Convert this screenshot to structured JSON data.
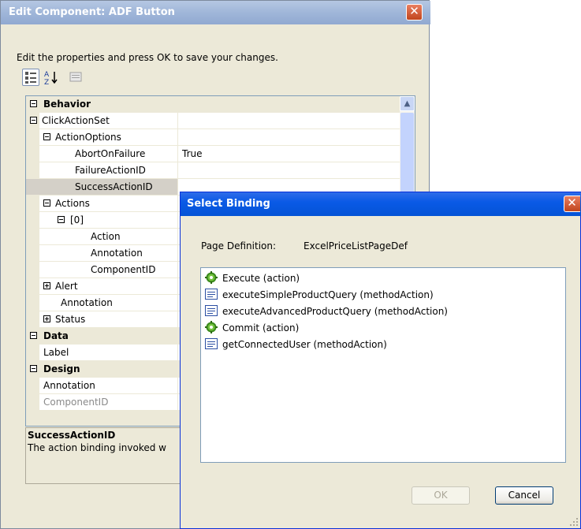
{
  "main_dialog": {
    "title": "Edit Component: ADF Button",
    "instructions": "Edit the properties and press OK to save your changes.",
    "toolbar": [
      "categorized-icon",
      "alphabetical-icon",
      "property-pages-icon"
    ],
    "grid": {
      "rows": [
        {
          "name": "Behavior",
          "value": "",
          "type": "category"
        },
        {
          "name": "ClickActionSet",
          "value": ""
        },
        {
          "name": "ActionOptions",
          "value": ""
        },
        {
          "name": "AbortOnFailure",
          "value": "True"
        },
        {
          "name": "FailureActionID",
          "value": ""
        },
        {
          "name": "SuccessActionID",
          "value": "",
          "selected": true
        },
        {
          "name": "Actions",
          "value": ""
        },
        {
          "name": "[0]",
          "value": ""
        },
        {
          "name": "Action",
          "value": ""
        },
        {
          "name": "Annotation",
          "value": ""
        },
        {
          "name": "ComponentID",
          "value": ""
        },
        {
          "name": "Alert",
          "value": ""
        },
        {
          "name": "Annotation",
          "value": ""
        },
        {
          "name": "Status",
          "value": ""
        },
        {
          "name": "Data",
          "value": "",
          "type": "category"
        },
        {
          "name": "Label",
          "value": ""
        },
        {
          "name": "Design",
          "value": "",
          "type": "category"
        },
        {
          "name": "Annotation",
          "value": ""
        },
        {
          "name": "ComponentID",
          "value": "",
          "disabled": true
        }
      ]
    },
    "description": {
      "title": "SuccessActionID",
      "text": "The action binding invoked w"
    }
  },
  "select_binding": {
    "title": "Select Binding",
    "page_definition_label": "Page Definition:",
    "page_definition_value": "ExcelPriceListPageDef",
    "items": [
      {
        "label": "Execute (action)",
        "icon": "gear-icon"
      },
      {
        "label": "executeSimpleProductQuery (methodAction)",
        "icon": "method-icon"
      },
      {
        "label": "executeAdvancedProductQuery (methodAction)",
        "icon": "method-icon"
      },
      {
        "label": "Commit (action)",
        "icon": "gear-icon"
      },
      {
        "label": "getConnectedUser (methodAction)",
        "icon": "method-icon"
      }
    ],
    "ok_label": "OK",
    "cancel_label": "Cancel"
  }
}
